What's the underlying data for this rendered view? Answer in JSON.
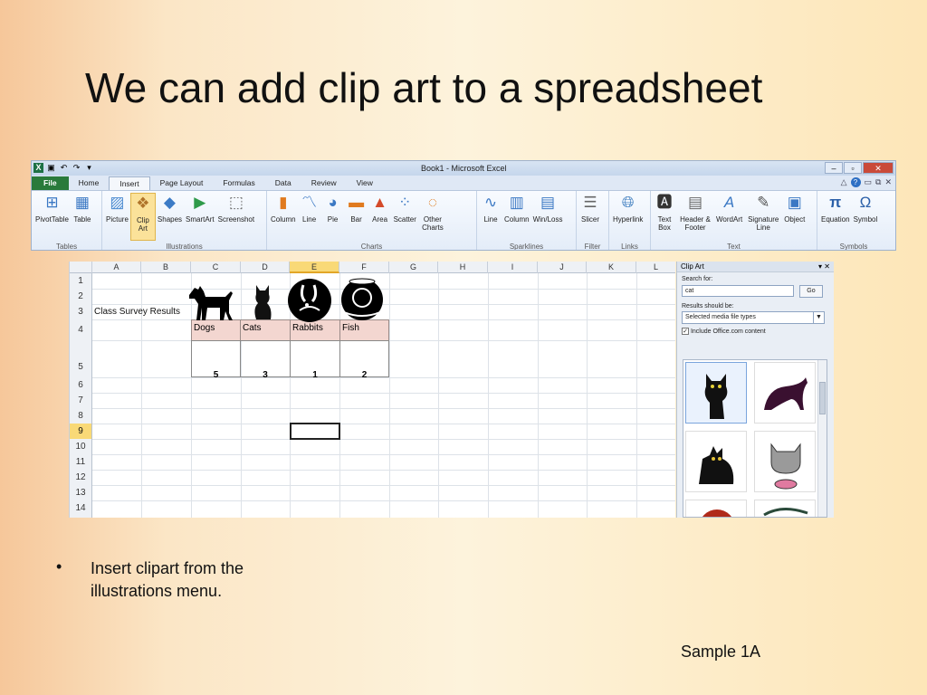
{
  "slide": {
    "title": "We can add clip art to a spreadsheet",
    "bullet_marker": "•",
    "bullet_text": "Insert clipart from the illustrations menu.",
    "footer": "Sample 1A"
  },
  "excel": {
    "window_title": "Book1 - Microsoft Excel",
    "tabs": [
      "File",
      "Home",
      "Insert",
      "Page Layout",
      "Formulas",
      "Data",
      "Review",
      "View"
    ],
    "active_tab": "Insert",
    "groups": {
      "tables": {
        "label": "Tables",
        "buttons": [
          "PivotTable",
          "Table"
        ]
      },
      "illustrations": {
        "label": "Illustrations",
        "buttons": [
          "Picture",
          "Clip Art",
          "Shapes",
          "SmartArt",
          "Screenshot"
        ]
      },
      "charts": {
        "label": "Charts",
        "buttons": [
          "Column",
          "Line",
          "Pie",
          "Bar",
          "Area",
          "Scatter",
          "Other Charts"
        ]
      },
      "sparklines": {
        "label": "Sparklines",
        "buttons": [
          "Line",
          "Column",
          "Win/Loss"
        ]
      },
      "filter": {
        "label": "Filter",
        "buttons": [
          "Slicer"
        ]
      },
      "links": {
        "label": "Links",
        "buttons": [
          "Hyperlink"
        ]
      },
      "text": {
        "label": "Text",
        "buttons": [
          "Text Box",
          "Header & Footer",
          "WordArt",
          "Signature Line",
          "Object"
        ]
      },
      "symbols": {
        "label": "Symbols",
        "buttons": [
          "Equation",
          "Symbol"
        ]
      }
    }
  },
  "sheet": {
    "columns": [
      "A",
      "B",
      "C",
      "D",
      "E",
      "F",
      "G",
      "H",
      "I",
      "J",
      "K",
      "L"
    ],
    "rows": [
      "1",
      "2",
      "3",
      "4",
      "5",
      "6",
      "7",
      "8",
      "9",
      "10",
      "11",
      "12",
      "13",
      "14"
    ],
    "selected_column": "E",
    "selected_row": "9",
    "label": "Class Survey Results",
    "headers": [
      "Dogs",
      "Cats",
      "Rabbits",
      "Fish"
    ],
    "values": [
      "5",
      "3",
      "1",
      "2"
    ],
    "clipart": [
      "dog-icon",
      "cat-icon",
      "rabbit-icon",
      "fishbowl-icon"
    ]
  },
  "clip_art_pane": {
    "title": "Clip Art",
    "search_label": "Search for:",
    "search_value": "cat",
    "go_label": "Go",
    "results_label": "Results should be:",
    "results_value": "Selected media file types",
    "include_label": "Include Office.com content",
    "include_checked": true
  },
  "colors": {
    "file_tab": "#2a7a3b",
    "header_fill": "#f3d6d0",
    "selection": "#f9d977"
  }
}
